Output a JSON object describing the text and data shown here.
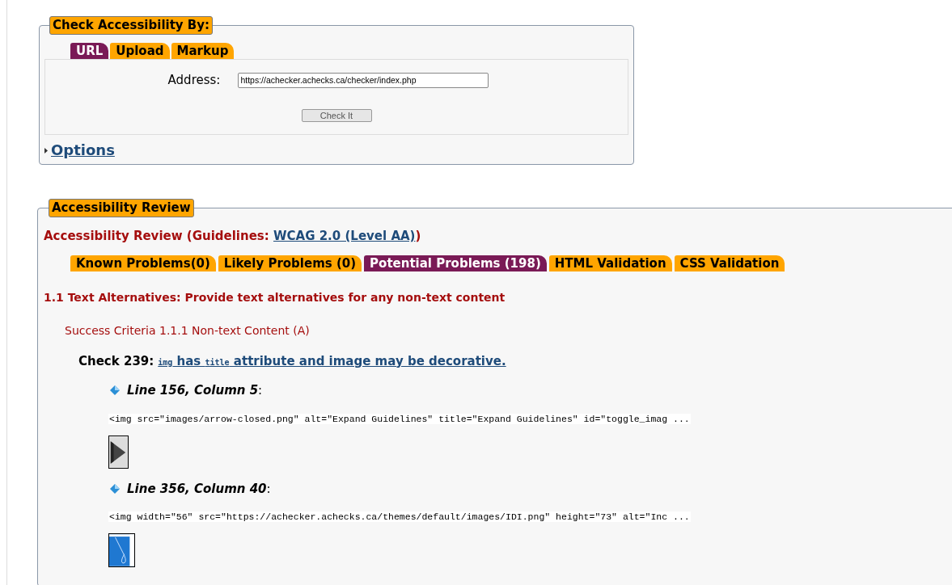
{
  "check_panel": {
    "legend": "Check Accessibility By:",
    "tabs": [
      {
        "label": "URL",
        "selected": true
      },
      {
        "label": "Upload",
        "selected": false
      },
      {
        "label": "Markup",
        "selected": false
      }
    ],
    "address_label": "Address:",
    "address_value": "https://achecker.achecks.ca/checker/index.php",
    "submit": "Check It",
    "options_link": "Options",
    "options_expanded": false
  },
  "review": {
    "legend": "Accessibility Review",
    "heading_prefix": "Accessibility Review (Guidelines: ",
    "guideline_link": "WCAG 2.0 (Level AA)",
    "heading_suffix": ")",
    "tabs": [
      {
        "label": "Known Problems(0)",
        "selected": false
      },
      {
        "label": "Likely Problems (0)",
        "selected": false
      },
      {
        "label": "Potential Problems (198)",
        "selected": true
      },
      {
        "label": "HTML Validation",
        "selected": false
      },
      {
        "label": "CSS Validation",
        "selected": false
      }
    ],
    "guideline": "1.1 Text Alternatives: Provide text alternatives for any non-text content",
    "criterion": "Success Criteria 1.1.1 Non-text Content (A)",
    "check_label": "Check 239:",
    "check_link": [
      {
        "kind": "code",
        "text": "img"
      },
      {
        "kind": "text",
        "text": " has "
      },
      {
        "kind": "code",
        "text": "title"
      },
      {
        "kind": "text",
        "text": " attribute and image may be decorative."
      }
    ],
    "occurrences": [
      {
        "location": "Line 156, Column 5",
        "colon": ":",
        "code": "<img src=\"images/arrow-closed.png\" alt=\"Expand Guidelines\" title=\"Expand Guidelines\" id=\"toggle_imag ...",
        "thumbnail": {
          "kind": "arrow"
        }
      },
      {
        "location": "Line 356, Column 40",
        "colon": ":",
        "code": "<img width=\"56\" src=\"https://achecker.achecks.ca/themes/default/images/IDI.png\" height=\"73\" alt=\"Inc ...",
        "thumbnail": {
          "kind": "logo"
        }
      }
    ]
  }
}
